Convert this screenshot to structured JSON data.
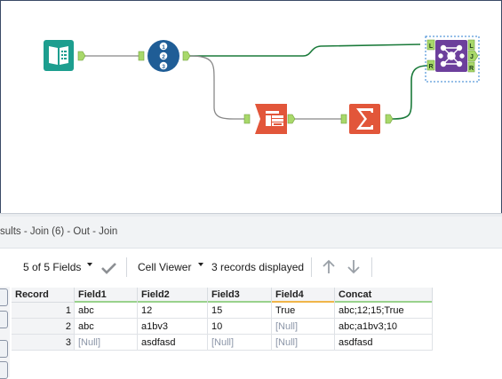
{
  "results": {
    "title": "sults - Join (6) - Out - Join",
    "toolbar": {
      "fields_label": "5 of 5 Fields",
      "viewer_label": "Cell Viewer",
      "records_label": "3 records displayed"
    },
    "columns": [
      "Record",
      "Field1",
      "Field2",
      "Field3",
      "Field4",
      "Concat"
    ],
    "column_bar_colors": [
      "",
      "#99d28c",
      "#99d28c",
      "#99d28c",
      "#f0b54a",
      "#99d28c"
    ],
    "rows": [
      [
        "1",
        "abc",
        "12",
        "15",
        "True",
        "abc;12;15;True"
      ],
      [
        "2",
        "abc",
        "a1bv3",
        "10",
        "[Null]",
        "abc;a1bv3;10"
      ],
      [
        "3",
        "[Null]",
        "asdfasd",
        "[Null]",
        "[Null]",
        "asdfasd"
      ]
    ]
  },
  "workflow": {
    "tools": [
      {
        "name": "input-data-tool",
        "icon": "book-icon",
        "color": "#1d9e8f"
      },
      {
        "name": "record-id-tool",
        "icon": "record-id-icon",
        "color": "#1f5d96"
      },
      {
        "name": "cross-tab-tool",
        "icon": "cross-tab-icon",
        "color": "#e2563a"
      },
      {
        "name": "summarize-tool",
        "icon": "sigma-icon",
        "color": "#e2563a"
      },
      {
        "name": "join-tool",
        "icon": "join-icon",
        "color": "#6c3f9c"
      }
    ],
    "record_id_digits": [
      "1",
      "2",
      "3"
    ],
    "join_anchors": {
      "left_in": "L",
      "right_in": "R",
      "left_out": "L",
      "join_out": "J",
      "right_out": "R"
    },
    "connection_color": "#1a7a3a",
    "selection_color": "#2c7fd0"
  },
  "left_strip": {
    "buttons": [
      "",
      "",
      "",
      ""
    ]
  }
}
